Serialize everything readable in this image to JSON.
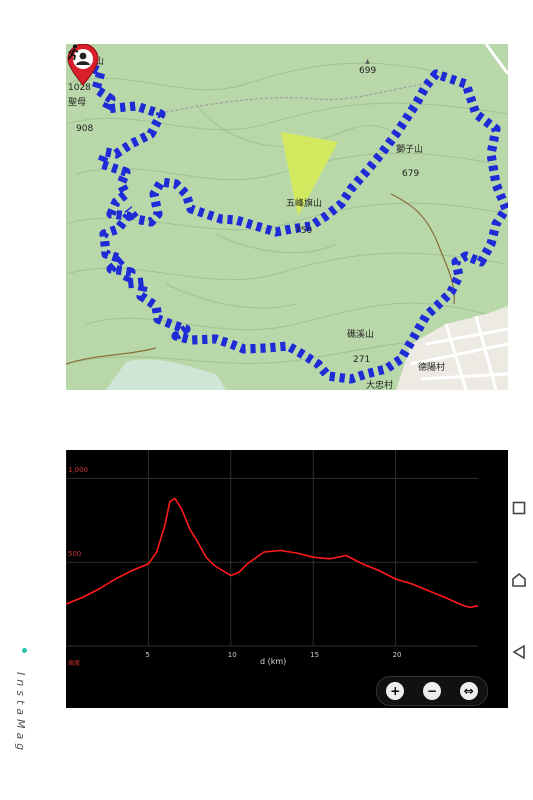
{
  "map": {
    "labels": [
      {
        "key": "sanjiao",
        "text": "三角崙山"
      },
      {
        "key": "e1028",
        "text": "1028"
      },
      {
        "key": "shengmu",
        "text": "聖母"
      },
      {
        "key": "e908",
        "text": "908"
      },
      {
        "key": "e699",
        "text": "699"
      },
      {
        "key": "shizi",
        "text": "獅子山"
      },
      {
        "key": "e679",
        "text": "679"
      },
      {
        "key": "wufeng",
        "text": "五峰旗山"
      },
      {
        "key": "e750",
        "text": "750"
      },
      {
        "key": "jiaoxi",
        "text": "礁溪山"
      },
      {
        "key": "e271",
        "text": "271"
      },
      {
        "key": "deyang",
        "text": "德陽村"
      },
      {
        "key": "dazhong",
        "text": "大忠村"
      }
    ],
    "route_color": "#dd1f2a",
    "arrow_color": "#1e2bd6",
    "pin_icon": "user-location-pin-icon",
    "hiker_icon": "hiker-icon"
  },
  "elevation": {
    "y_ticks": [
      "1,000",
      "500"
    ],
    "x_ticks": [
      "5",
      "10",
      "15",
      "20"
    ],
    "x_axis_label": "d (km)",
    "origin_label": "高度",
    "line_color": "#ff1a1a",
    "zoom_controls": [
      {
        "key": "zoom_in",
        "icon": "zoom-in-icon",
        "glyph": "+"
      },
      {
        "key": "zoom_out",
        "icon": "zoom-out-icon",
        "glyph": "−"
      },
      {
        "key": "fit",
        "icon": "fit-icon",
        "glyph": "⇔"
      }
    ]
  },
  "nav": {
    "recent_icon": "recent-apps-icon",
    "home_icon": "home-icon",
    "back_icon": "back-icon"
  },
  "brand": {
    "name": "InstaMag",
    "accent": "#27c2a9"
  },
  "chart_data": {
    "type": "line",
    "title": "",
    "xlabel": "d (km)",
    "ylabel": "",
    "xlim": [
      0,
      25
    ],
    "ylim": [
      0,
      1050
    ],
    "x": [
      0,
      1,
      2,
      3,
      4,
      5,
      5.5,
      6,
      6.3,
      6.6,
      7,
      7.5,
      8,
      8.5,
      9,
      9.5,
      10,
      10.5,
      11,
      12,
      13,
      14,
      15,
      16,
      17,
      18,
      19,
      20,
      21,
      22,
      23,
      24,
      24.5,
      25
    ],
    "series": [
      {
        "values": [
          250,
          290,
          340,
          400,
          450,
          490,
          560,
          720,
          860,
          880,
          820,
          700,
          620,
          530,
          480,
          450,
          420,
          440,
          490,
          560,
          570,
          555,
          530,
          520,
          540,
          490,
          450,
          400,
          370,
          330,
          290,
          245,
          230,
          240
        ]
      }
    ]
  }
}
